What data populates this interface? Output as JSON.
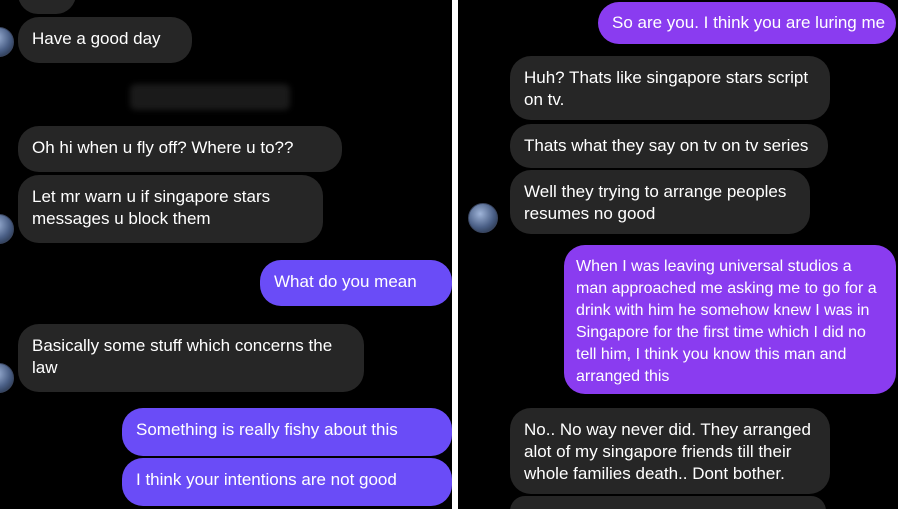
{
  "left_chat": {
    "messages": [
      {
        "from": "them",
        "text": "Have a good day"
      },
      {
        "from": "them",
        "text": "Oh hi when u fly off? Where u to??"
      },
      {
        "from": "them",
        "text": "Let mr warn u if singapore stars messages u block them"
      },
      {
        "from": "me",
        "text": "What do you mean"
      },
      {
        "from": "them",
        "text": "Basically some stuff which concerns the law"
      },
      {
        "from": "me",
        "text": "Something is really fishy about this"
      },
      {
        "from": "me",
        "text": "I think your intentions are not good"
      }
    ]
  },
  "right_chat": {
    "messages": [
      {
        "from": "me",
        "text": "So are you. I think you are luring me"
      },
      {
        "from": "them",
        "text": "Huh? Thats like singapore stars script on tv."
      },
      {
        "from": "them",
        "text": "Thats what they say on tv on tv series"
      },
      {
        "from": "them",
        "text": "Well they trying to arrange peoples resumes no good"
      },
      {
        "from": "me",
        "text": "When I was leaving universal studios a man approached me asking me to go for a drink with him he somehow knew I was in Singapore for the first time which I did no tell him, I think you know this man and arranged this"
      },
      {
        "from": "them",
        "text": "No.. No way never did. They arranged alot of my singapore friends till their whole families death.. Dont bother."
      }
    ]
  },
  "colors": {
    "background": "#000000",
    "received_bubble": "#262626",
    "sent_bubble": "#7a42f5",
    "divider": "#ffffff"
  }
}
